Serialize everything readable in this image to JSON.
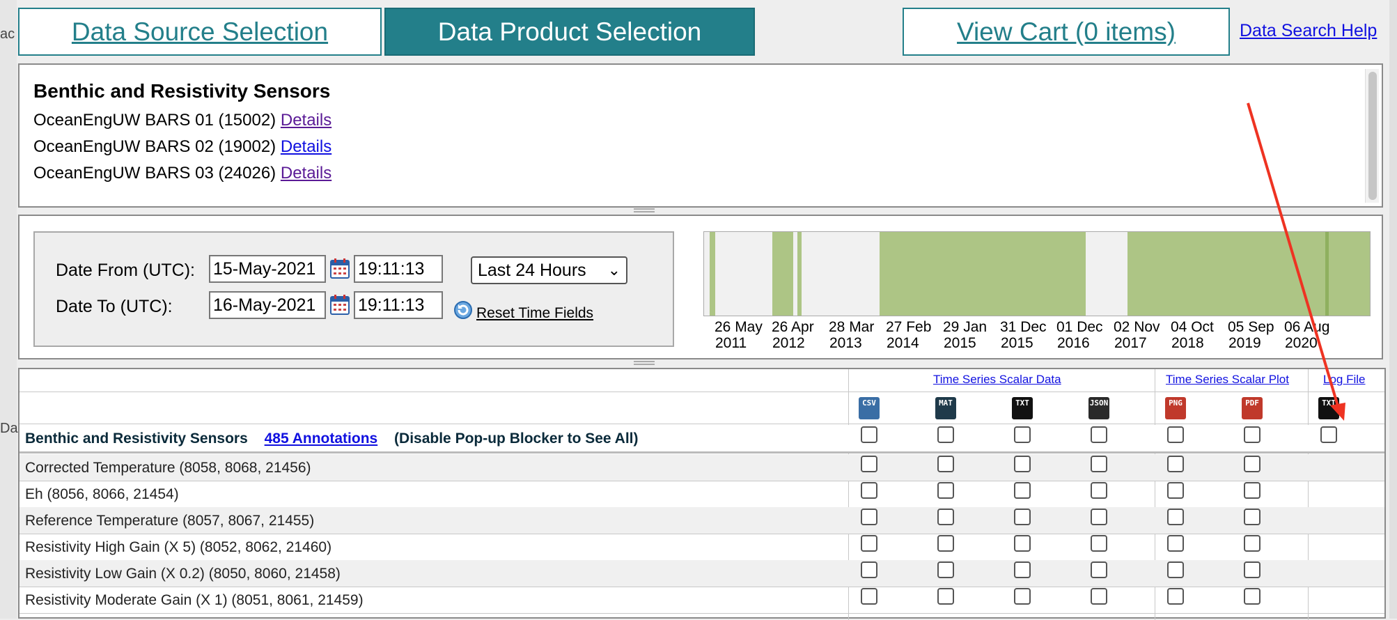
{
  "tabs": {
    "source": "Data Source Selection",
    "product": "Data Product Selection",
    "cart": "View Cart (0 items)",
    "help": "Data Search Help"
  },
  "edge_left": {
    "top": "ac",
    "bottom": "Da"
  },
  "devices": {
    "title": "Benthic and Resistivity Sensors",
    "items": [
      {
        "name": "OceanEngUW BARS 01 (15002)",
        "link": "Details"
      },
      {
        "name": "OceanEngUW BARS 02 (19002)",
        "link": "Details"
      },
      {
        "name": "OceanEngUW BARS 03 (24026)",
        "link": "Details"
      }
    ]
  },
  "time": {
    "from_label": "Date From (UTC):",
    "to_label": "Date To (UTC):",
    "from_date": "15-May-2021",
    "from_time": "19:11:13",
    "to_date": "16-May-2021",
    "to_time": "19:11:13",
    "range": "Last 24 Hours",
    "reset": "Reset Time Fields"
  },
  "timeline": {
    "ticks": [
      {
        "day": "26 May",
        "year": "2011"
      },
      {
        "day": "26 Apr",
        "year": "2012"
      },
      {
        "day": "28 Mar",
        "year": "2013"
      },
      {
        "day": "27 Feb",
        "year": "2014"
      },
      {
        "day": "29 Jan",
        "year": "2015"
      },
      {
        "day": "31 Dec",
        "year": "2015"
      },
      {
        "day": "01 Dec",
        "year": "2016"
      },
      {
        "day": "02 Nov",
        "year": "2017"
      },
      {
        "day": "04 Oct",
        "year": "2018"
      },
      {
        "day": "05 Sep",
        "year": "2019"
      },
      {
        "day": "06 Aug",
        "year": "2020"
      }
    ]
  },
  "table": {
    "groups": {
      "scalar_data": "Time Series Scalar Data",
      "scalar_plot": "Time Series Scalar Plot",
      "log_file": "Log File"
    },
    "icons": [
      {
        "name": "csv-icon",
        "text": "CSV",
        "color": "#3a6ea5"
      },
      {
        "name": "mat-icon",
        "text": "MAT",
        "color": "#1f3a4a"
      },
      {
        "name": "txt-icon",
        "text": "TXT",
        "color": "#111111"
      },
      {
        "name": "json-icon",
        "text": "JSON",
        "color": "#2a2a2a"
      },
      {
        "name": "png-icon",
        "text": "PNG",
        "color": "#c0392b"
      },
      {
        "name": "pdf-icon",
        "text": "PDF",
        "color": "#c0392b"
      },
      {
        "name": "log-txt-icon",
        "text": "TXT",
        "color": "#111111"
      }
    ],
    "group_row": {
      "title": "Benthic and Resistivity Sensors",
      "annotations": "485 Annotations",
      "note": "(Disable Pop-up Blocker to See All)"
    },
    "rows": [
      "Corrected Temperature (8058, 8068, 21456)",
      "Eh (8056, 8066, 21454)",
      "Reference Temperature (8057, 8067, 21455)",
      "Resistivity High Gain (X 5) (8052, 8062, 21460)",
      "Resistivity Low Gain (X 0.2) (8050, 8060, 21458)",
      "Resistivity Moderate Gain (X 1) (8051, 8061, 21459)"
    ]
  },
  "colors": {
    "accent": "#237f8a",
    "timeline_fill": "#adc585",
    "arrow": "#ee3322"
  }
}
